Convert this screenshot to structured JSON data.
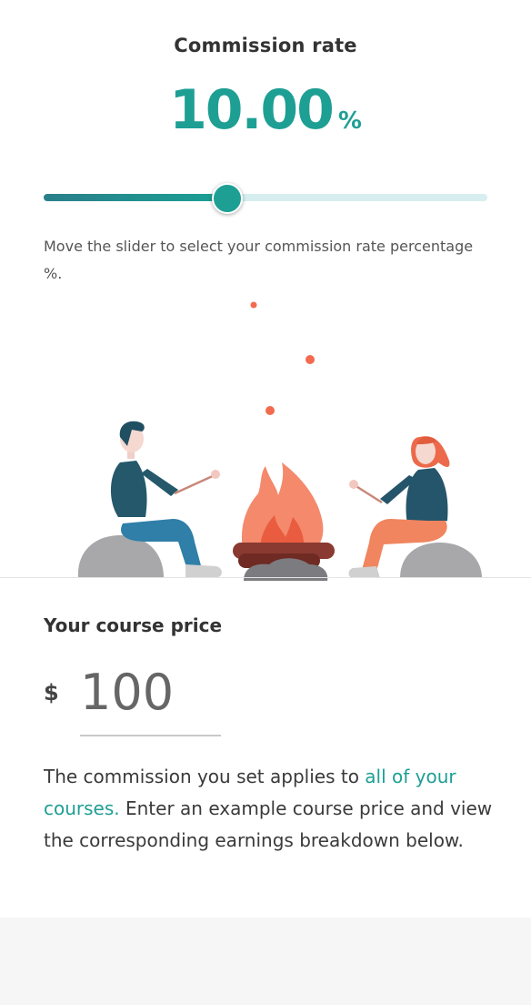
{
  "commission": {
    "title": "Commission rate",
    "value": "10.00",
    "unit": "%",
    "slider_fraction": 0.41
  },
  "hint": "Move the slider to select your commission rate percentage %.",
  "price": {
    "label": "Your course price",
    "currency": "$",
    "value": "100"
  },
  "info": {
    "prefix": "The commission you set applies to ",
    "link": "all of your courses.",
    "suffix": " Enter an example course price and view the corresponding earnings breakdown below."
  },
  "colors": {
    "accent": "#1e9f94",
    "slider_track": "#d7eef0",
    "flame": "#f26b4f",
    "footer": "#f6f6f6"
  }
}
